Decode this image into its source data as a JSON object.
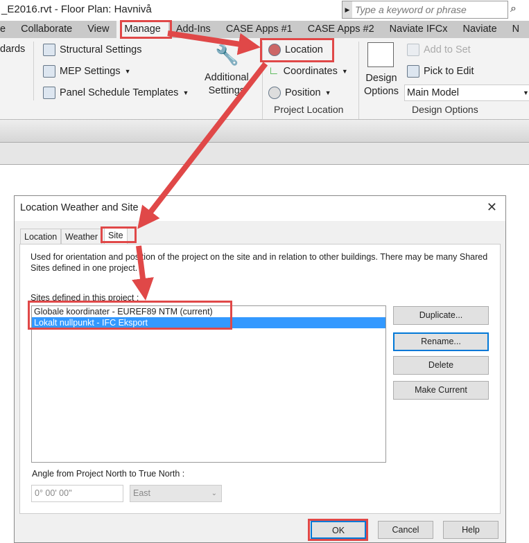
{
  "app": {
    "title": "_E2016.rvt - Floor Plan: Havnivå",
    "search_placeholder": "Type a keyword or phrase"
  },
  "ribbon_tabs": [
    "e",
    "Collaborate",
    "View",
    "Manage",
    "Add-Ins",
    "CASE Apps #1",
    "CASE Apps #2",
    "Naviate IFCx",
    "Naviate",
    "N"
  ],
  "active_tab": "Manage",
  "ribbon": {
    "standards": "dards",
    "structural_settings": "Structural  Settings",
    "mep_settings": "MEP  Settings",
    "panel_schedule": "Panel Schedule  Templates",
    "additional_settings_1": "Additional",
    "additional_settings_2": "Settings",
    "location": "Location",
    "coordinates": "Coordinates",
    "position": "Position",
    "project_location_label": "Project Location",
    "design_options_1": "Design",
    "design_options_2": "Options",
    "add_to_set": "Add to Set",
    "pick_to_edit": "Pick to Edit",
    "main_model": "Main Model",
    "design_options_label": "Design Options"
  },
  "dialog": {
    "title": "Location Weather and Site",
    "tabs": [
      "Location",
      "Weather",
      "Site"
    ],
    "active_tab": "Site",
    "description": "Used for orientation and position of the project on the site and in relation to other buildings. There may be many Shared Sites defined in one project.",
    "sites_label": "Sites defined in this project :",
    "sites": [
      "Globale koordinater - EUREF89 NTM (current)",
      "Lokalt nullpunkt - IFC Eksport"
    ],
    "selected_site": "Lokalt nullpunkt - IFC Eksport",
    "buttons": {
      "duplicate": "Duplicate...",
      "rename": "Rename...",
      "delete": "Delete",
      "make_current": "Make Current"
    },
    "angle_label": "Angle from Project North to True North :",
    "angle_value": "0° 00' 00\"",
    "direction": "East",
    "ok": "OK",
    "cancel": "Cancel",
    "help": "Help"
  },
  "colors": {
    "annotation_red": "#e04848",
    "selection_blue": "#3399ff",
    "focus_blue": "#0078d7"
  }
}
